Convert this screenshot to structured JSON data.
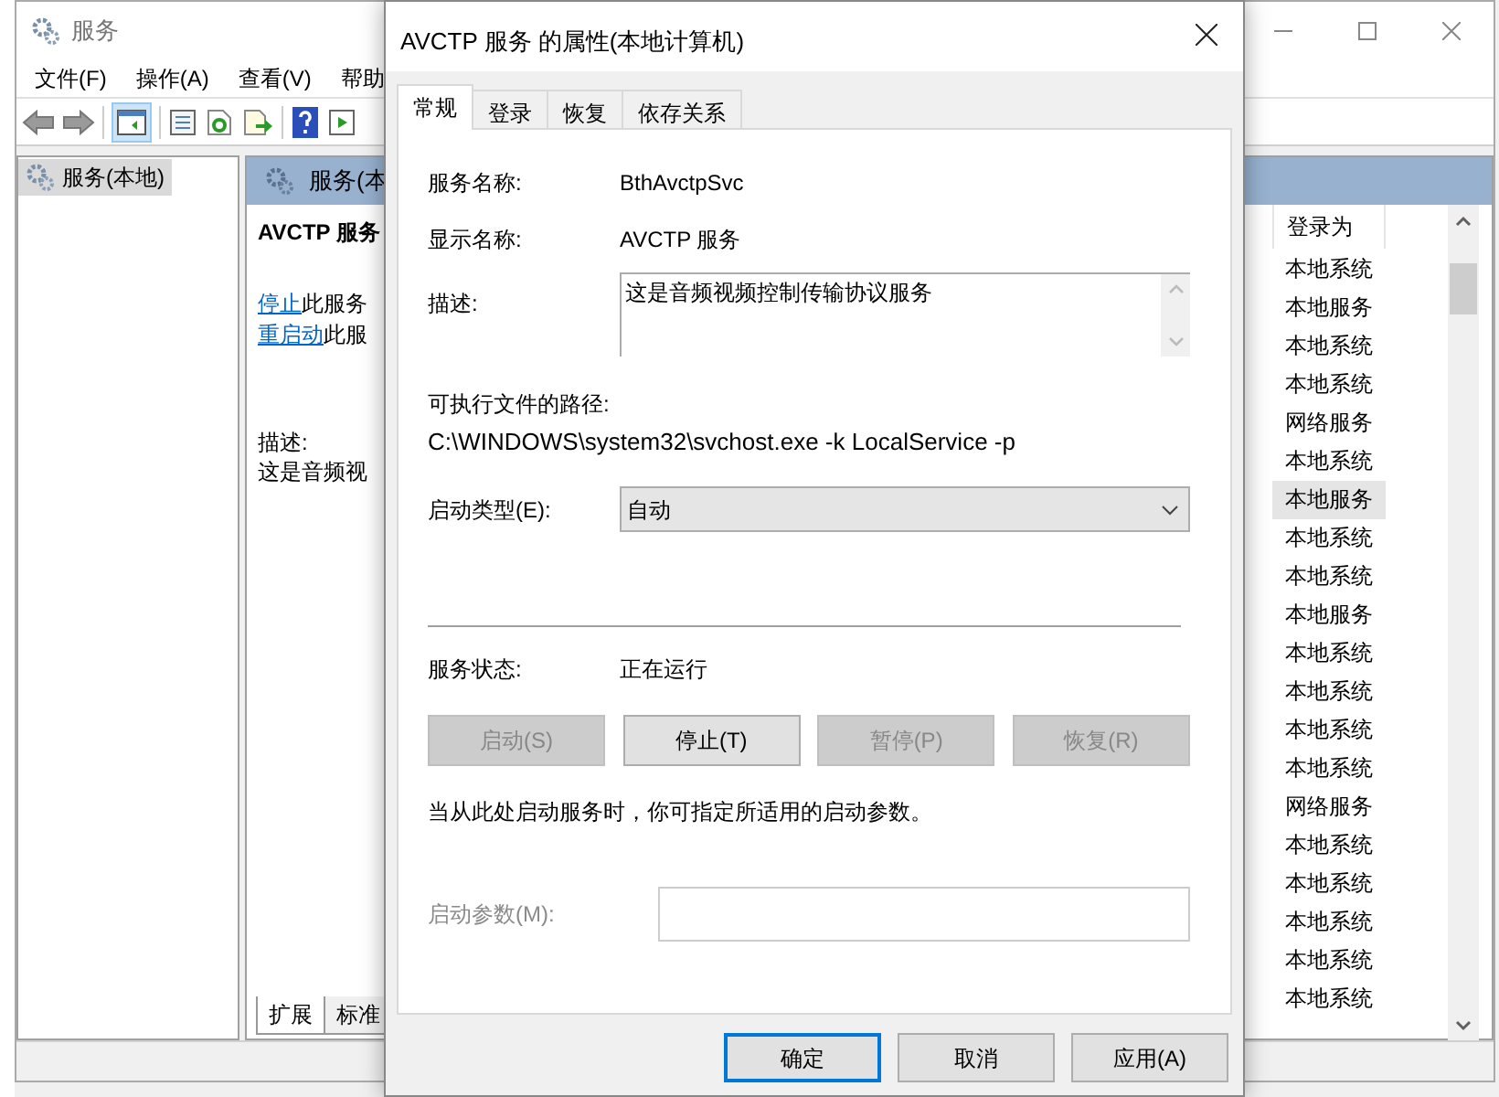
{
  "services_window": {
    "title": "服务",
    "menu": [
      "文件(F)",
      "操作(A)",
      "查看(V)",
      "帮助"
    ],
    "tree": [
      {
        "label": "服务(本地)",
        "selected": true
      }
    ],
    "detail_header": "服务(本",
    "detail_title": "AVCTP 服务",
    "actions": [
      {
        "link": "停止",
        "text": "此服务"
      },
      {
        "link": "重启动",
        "text": "此服"
      }
    ],
    "description_label": "描述:",
    "description": "这是音频视",
    "view_tabs": [
      {
        "label": "扩展",
        "selected": true
      },
      {
        "label": "标准",
        "selected": false
      }
    ],
    "list": {
      "columns": [
        "登录为"
      ],
      "rows": [
        {
          "log_on_as": "本地系统",
          "selected": false
        },
        {
          "log_on_as": "本地服务",
          "selected": false
        },
        {
          "log_on_as": "本地系统",
          "selected": false
        },
        {
          "log_on_as": "本地系统",
          "selected": false
        },
        {
          "log_on_as": "网络服务",
          "selected": false
        },
        {
          "log_on_as": "本地系统",
          "selected": false
        },
        {
          "log_on_as": "本地服务",
          "selected": true
        },
        {
          "log_on_as": "本地系统",
          "selected": false
        },
        {
          "log_on_as": "本地系统",
          "selected": false
        },
        {
          "log_on_as": "本地服务",
          "selected": false
        },
        {
          "log_on_as": "本地系统",
          "selected": false
        },
        {
          "log_on_as": "本地系统",
          "selected": false
        },
        {
          "log_on_as": "本地系统",
          "selected": false
        },
        {
          "log_on_as": "本地系统",
          "selected": false
        },
        {
          "log_on_as": "网络服务",
          "selected": false
        },
        {
          "log_on_as": "本地系统",
          "selected": false
        },
        {
          "log_on_as": "本地系统",
          "selected": false
        },
        {
          "log_on_as": "本地系统",
          "selected": false
        },
        {
          "log_on_as": "本地系统",
          "selected": false
        },
        {
          "log_on_as": "本地系统",
          "selected": false
        }
      ]
    }
  },
  "dialog": {
    "title": "AVCTP 服务 的属性(本地计算机)",
    "tabs": [
      {
        "label": "常规",
        "selected": true
      },
      {
        "label": "登录",
        "selected": false
      },
      {
        "label": "恢复",
        "selected": false
      },
      {
        "label": "依存关系",
        "selected": false
      }
    ],
    "service_name": {
      "label": "服务名称:",
      "value": "BthAvctpSvc"
    },
    "display_name": {
      "label": "显示名称:",
      "value": "AVCTP 服务"
    },
    "description": {
      "label": "描述:",
      "value": "这是音频视频控制传输协议服务"
    },
    "path": {
      "label": "可执行文件的路径:",
      "value": "C:\\WINDOWS\\system32\\svchost.exe -k LocalService -p"
    },
    "startup_type": {
      "label": "启动类型(E):",
      "value": "自动"
    },
    "status": {
      "label": "服务状态:",
      "value": "正在运行"
    },
    "service_buttons": [
      {
        "label": "启动(S)",
        "disabled": true
      },
      {
        "label": "停止(T)",
        "disabled": false
      },
      {
        "label": "暂停(P)",
        "disabled": true
      },
      {
        "label": "恢复(R)",
        "disabled": true
      }
    ],
    "hint": "当从此处启动服务时，你可指定所适用的启动参数。",
    "start_params": {
      "label": "启动参数(M):",
      "disabled": true
    },
    "footer_buttons": [
      {
        "label": "确定",
        "focused": true
      },
      {
        "label": "取消",
        "focused": false
      },
      {
        "label": "应用(A)",
        "focused": false
      }
    ]
  }
}
